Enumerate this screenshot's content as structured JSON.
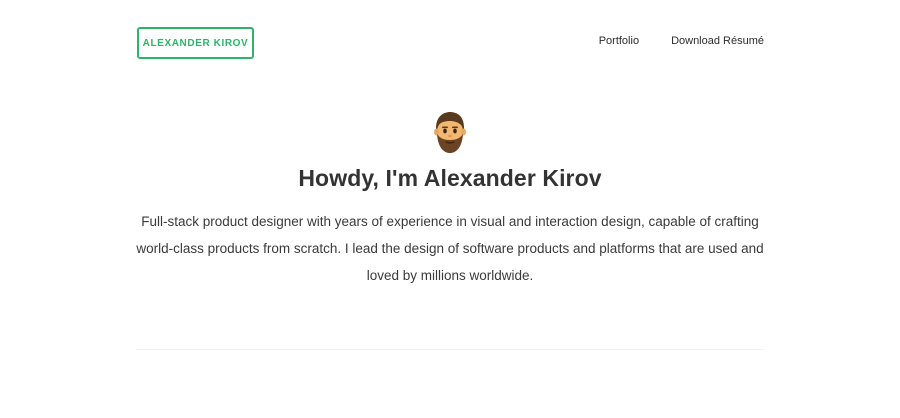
{
  "header": {
    "logo_label": "ALEXANDER KIROV",
    "nav": {
      "portfolio": "Portfolio",
      "download_resume": "Download Résumé"
    }
  },
  "hero": {
    "avatar_icon": "bearded-man-emoji-icon",
    "title": "Howdy, I'm Alexander Kirov",
    "intro": "Full-stack product designer with years of experience in visual and interaction design, capable of crafting world-class products from scratch. I lead the design of software products and platforms that are used and loved by millions worldwide."
  },
  "colors": {
    "accent": "#2fb36a",
    "text": "#333333",
    "divider": "#f0f0f0"
  }
}
